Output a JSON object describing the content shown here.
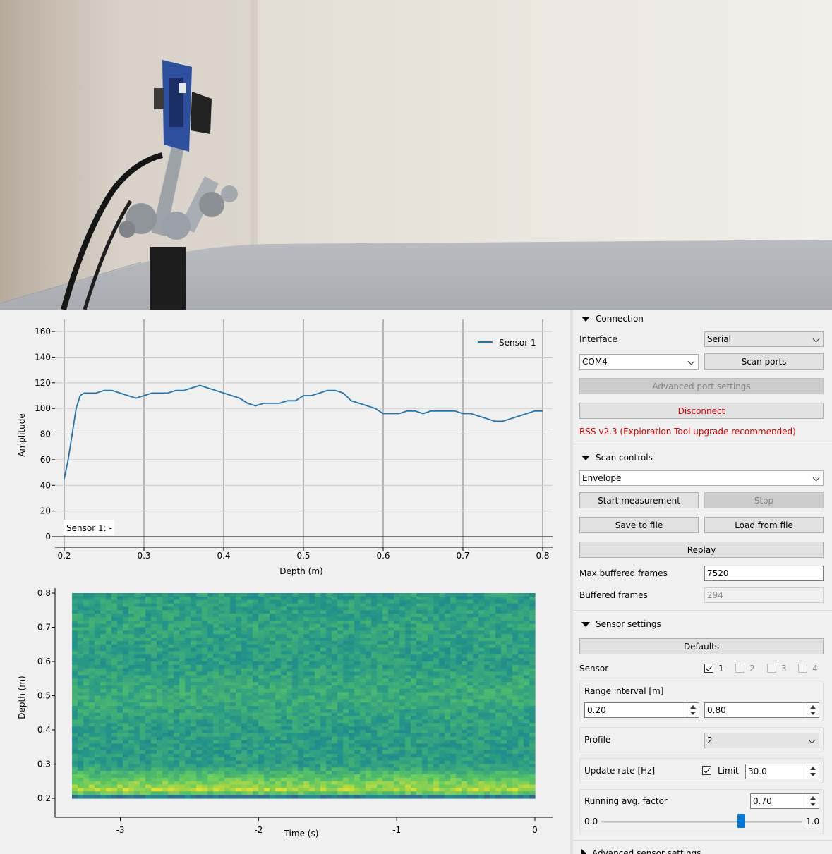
{
  "photo": {
    "description_icon": "sensor-rig-photo"
  },
  "line_plot": {
    "legend": "Sensor 1",
    "overlay_text": "Sensor 1: -",
    "xlabel": "Depth (m)",
    "ylabel": "Amplitude",
    "series_color": "#1f77b4"
  },
  "heatmap_plot": {
    "xlabel": "Time (s)",
    "ylabel": "Depth (m)"
  },
  "chart_data": [
    {
      "type": "line",
      "title": "",
      "xlabel": "Depth (m)",
      "ylabel": "Amplitude",
      "xlim": [
        0.2,
        0.8
      ],
      "ylim": [
        0,
        165
      ],
      "xticks": [
        "0.2",
        "0.3",
        "0.4",
        "0.5",
        "0.6",
        "0.7",
        "0.8"
      ],
      "yticks": [
        "0",
        "20",
        "40",
        "60",
        "80",
        "100",
        "120",
        "140",
        "160"
      ],
      "grid": true,
      "legend_position": "top-right",
      "series": [
        {
          "name": "Sensor 1",
          "x": [
            0.2,
            0.205,
            0.21,
            0.215,
            0.22,
            0.225,
            0.23,
            0.24,
            0.25,
            0.26,
            0.27,
            0.28,
            0.29,
            0.3,
            0.31,
            0.32,
            0.33,
            0.34,
            0.35,
            0.36,
            0.37,
            0.38,
            0.39,
            0.4,
            0.41,
            0.42,
            0.43,
            0.44,
            0.45,
            0.46,
            0.47,
            0.48,
            0.49,
            0.5,
            0.51,
            0.52,
            0.53,
            0.54,
            0.55,
            0.56,
            0.57,
            0.58,
            0.59,
            0.6,
            0.61,
            0.62,
            0.63,
            0.64,
            0.65,
            0.66,
            0.67,
            0.68,
            0.69,
            0.7,
            0.71,
            0.72,
            0.73,
            0.74,
            0.75,
            0.76,
            0.77,
            0.78,
            0.79,
            0.8
          ],
          "y": [
            45,
            60,
            80,
            100,
            110,
            112,
            112,
            112,
            114,
            114,
            112,
            110,
            108,
            110,
            112,
            112,
            112,
            114,
            114,
            116,
            118,
            116,
            114,
            112,
            110,
            108,
            104,
            102,
            104,
            104,
            104,
            106,
            106,
            110,
            110,
            112,
            114,
            114,
            112,
            106,
            104,
            102,
            100,
            96,
            96,
            96,
            98,
            98,
            96,
            98,
            98,
            98,
            98,
            96,
            96,
            94,
            92,
            90,
            90,
            92,
            94,
            96,
            98,
            98
          ]
        }
      ]
    },
    {
      "type": "heatmap",
      "title": "",
      "xlabel": "Time (s)",
      "ylabel": "Depth (m)",
      "xlim": [
        -3.35,
        0
      ],
      "ylim": [
        0.2,
        0.8
      ],
      "xticks": [
        "-3",
        "-2",
        "-1",
        "0"
      ],
      "yticks": [
        "0.2",
        "0.3",
        "0.4",
        "0.5",
        "0.6",
        "0.7",
        "0.8"
      ],
      "colormap": "viridis",
      "intensity_by_depth": [
        {
          "depth": 0.2,
          "level": 0.25
        },
        {
          "depth": 0.22,
          "level": 0.9
        },
        {
          "depth": 0.3,
          "level": 0.55
        },
        {
          "depth": 0.4,
          "level": 0.55
        },
        {
          "depth": 0.5,
          "level": 0.62
        },
        {
          "depth": 0.6,
          "level": 0.55
        },
        {
          "depth": 0.7,
          "level": 0.58
        },
        {
          "depth": 0.8,
          "level": 0.55
        }
      ]
    }
  ],
  "panel": {
    "connection": {
      "header": "Connection",
      "interface_label": "Interface",
      "interface_value": "Serial",
      "port_value": "COM4",
      "scan_ports": "Scan ports",
      "advanced_port_settings": "Advanced port settings",
      "disconnect": "Disconnect",
      "status": "RSS v2.3 (Exploration Tool upgrade recommended)"
    },
    "scan_controls": {
      "header": "Scan controls",
      "mode_value": "Envelope",
      "start": "Start measurement",
      "stop": "Stop",
      "save": "Save to file",
      "load": "Load from file",
      "replay": "Replay",
      "max_buffered_label": "Max buffered frames",
      "max_buffered_value": "7520",
      "buffered_label": "Buffered frames",
      "buffered_value": "294"
    },
    "sensor_settings": {
      "header": "Sensor settings",
      "defaults": "Defaults",
      "sensor_label": "Sensor",
      "sensors": [
        {
          "label": "1",
          "checked": true
        },
        {
          "label": "2",
          "checked": false
        },
        {
          "label": "3",
          "checked": false
        },
        {
          "label": "4",
          "checked": false
        }
      ],
      "range_label": "Range interval [m]",
      "range_start": "0.20",
      "range_end": "0.80",
      "profile_label": "Profile",
      "profile_value": "2",
      "update_rate_label": "Update rate [Hz]",
      "limit_label": "Limit",
      "limit_checked": true,
      "update_rate_value": "30.0",
      "running_avg_label": "Running avg. factor",
      "running_avg_value": "0.70",
      "slider_min": "0.0",
      "slider_max": "1.0",
      "slider_fraction": 0.7
    },
    "advanced_sensor": {
      "header": "Advanced sensor settings"
    }
  }
}
